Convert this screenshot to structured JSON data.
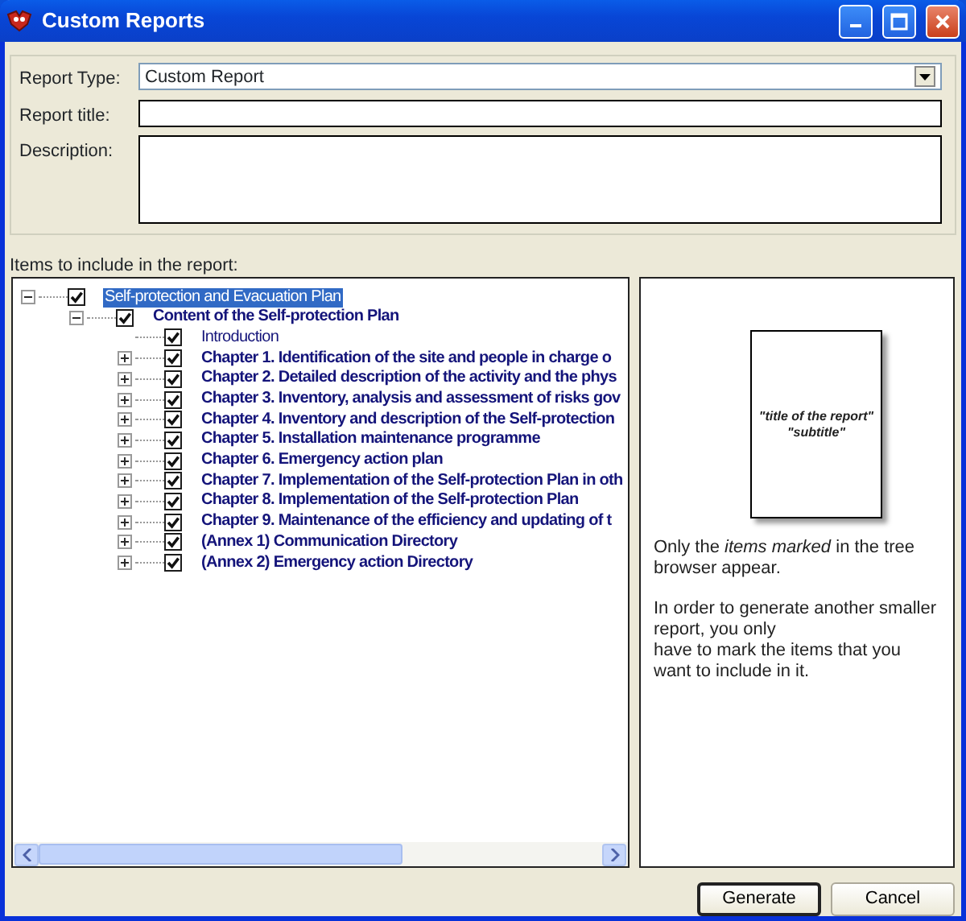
{
  "window": {
    "title": "Custom Reports"
  },
  "form": {
    "report_type": {
      "label": "Report Type:",
      "value": "Custom Report"
    },
    "report_title": {
      "label": "Report title:"
    },
    "description": {
      "label": "Description:"
    }
  },
  "tree": {
    "label": "Items to include in the report:",
    "items": [
      {
        "text": "Self-protection and Evacuation Plan",
        "bold": false,
        "checked": true,
        "selected": true,
        "expanded": true,
        "children": [
          {
            "text": "Content of the Self-protection Plan",
            "bold": true,
            "checked": true,
            "selected": false,
            "expanded": true,
            "children": [
              {
                "text": "Introduction",
                "bold": false,
                "checked": true,
                "selected": false
              },
              {
                "text": "Chapter 1. Identification of the site and people in charge o",
                "bold": true,
                "checked": true,
                "selected": false,
                "expanded": false
              },
              {
                "text": "Chapter 2. Detailed description of the activity and the phys",
                "bold": true,
                "checked": true,
                "selected": false,
                "expanded": false
              },
              {
                "text": "Chapter 3. Inventory, analysis and assessment of risks gov",
                "bold": true,
                "checked": true,
                "selected": false,
                "expanded": false
              },
              {
                "text": "Chapter 4. Inventory and description of the Self-protection",
                "bold": true,
                "checked": true,
                "selected": false,
                "expanded": false
              },
              {
                "text": "Chapter 5. Installation maintenance programme",
                "bold": true,
                "checked": true,
                "selected": false,
                "expanded": false
              },
              {
                "text": "Chapter 6. Emergency action plan",
                "bold": true,
                "checked": true,
                "selected": false,
                "expanded": false
              },
              {
                "text": "Chapter 7. Implementation of the Self-protection Plan in oth",
                "bold": true,
                "checked": true,
                "selected": false,
                "expanded": false
              },
              {
                "text": "Chapter 8. Implementation of the Self-protection Plan",
                "bold": true,
                "checked": true,
                "selected": false,
                "expanded": false
              },
              {
                "text": "Chapter 9. Maintenance of the efficiency and updating of t",
                "bold": true,
                "checked": true,
                "selected": false,
                "expanded": false
              },
              {
                "text": "(Annex 1) Communication Directory",
                "bold": true,
                "checked": true,
                "selected": false,
                "expanded": false
              },
              {
                "text": "(Annex 2) Emergency action Directory",
                "bold": true,
                "checked": true,
                "selected": false,
                "expanded": false
              }
            ]
          }
        ]
      }
    ]
  },
  "preview": {
    "page_title": "\"title of the report\"",
    "page_subtitle": "\"subtitle\"",
    "notes": [
      " Only the *items marked* in the tree browser appear.",
      "In order to generate another smaller report, you only\nhave to mark the items that you want to include in it."
    ]
  },
  "buttons": [
    {
      "label": "Generate",
      "default": true
    },
    {
      "label": "Cancel",
      "default": false
    }
  ]
}
